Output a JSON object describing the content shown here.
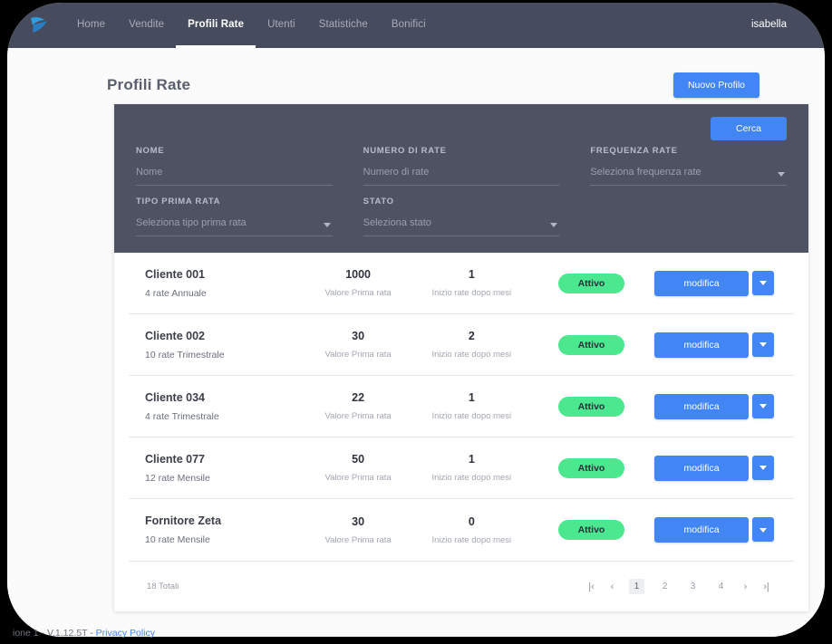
{
  "nav": {
    "logo_icon": "app-logo-icon",
    "items": [
      {
        "label": "Home",
        "active": false
      },
      {
        "label": "Vendite",
        "active": false
      },
      {
        "label": "Profili Rate",
        "active": true
      },
      {
        "label": "Utenti",
        "active": false
      },
      {
        "label": "Statistiche",
        "active": false
      },
      {
        "label": "Bonifici",
        "active": false
      }
    ],
    "user": "isabella"
  },
  "header": {
    "title": "Profili Rate",
    "new_profile_label": "Nuovo Profilo"
  },
  "filters": {
    "search_label": "Cerca",
    "fields": [
      {
        "label": "NOME",
        "placeholder": "Nome",
        "type": "text"
      },
      {
        "label": "NUMERO DI RATE",
        "placeholder": "Numero di rate",
        "type": "text"
      },
      {
        "label": "FREQUENZA RATE",
        "placeholder": "Seleziona frequenza rate",
        "type": "select"
      },
      {
        "label": "TIPO PRIMA RATA",
        "placeholder": "Seleziona tipo prima rata",
        "type": "select"
      },
      {
        "label": "STATO",
        "placeholder": "Seleziona stato",
        "type": "select"
      }
    ]
  },
  "table": {
    "value_caption": "Valore Prima rata",
    "start_caption": "Inizio rate dopo mesi",
    "edit_label": "modifica",
    "rows": [
      {
        "name": "Cliente 001",
        "detail": "4 rate Annuale",
        "value": "1000",
        "start_months": "1",
        "status": "Attivo"
      },
      {
        "name": "Cliente 002",
        "detail": "10 rate Trimestrale",
        "value": "30",
        "start_months": "2",
        "status": "Attivo"
      },
      {
        "name": "Cliente 034",
        "detail": "4 rate Trimestrale",
        "value": "22",
        "start_months": "1",
        "status": "Attivo"
      },
      {
        "name": "Cliente 077",
        "detail": "12 rate Mensile",
        "value": "50",
        "start_months": "1",
        "status": "Attivo"
      },
      {
        "name": "Fornitore Zeta",
        "detail": "10 rate Mensile",
        "value": "30",
        "start_months": "0",
        "status": "Attivo"
      }
    ]
  },
  "pagination": {
    "total_label": "18 Totali",
    "first_icon": "first-page-icon",
    "prev_icon": "prev-page-icon",
    "next_icon": "next-page-icon",
    "last_icon": "last-page-icon",
    "pages": [
      "1",
      "2",
      "3",
      "4"
    ],
    "current_page": "1"
  },
  "footer": {
    "text": "ione 1 - V.1.12.5T - ",
    "link_label": "Privacy Policy"
  },
  "colors": {
    "nav_bg": "#474b5e",
    "filter_bg": "#4e5263",
    "accent_blue": "#4285f4",
    "status_green": "#4ce88f",
    "page_bg": "#fbfbfb"
  }
}
